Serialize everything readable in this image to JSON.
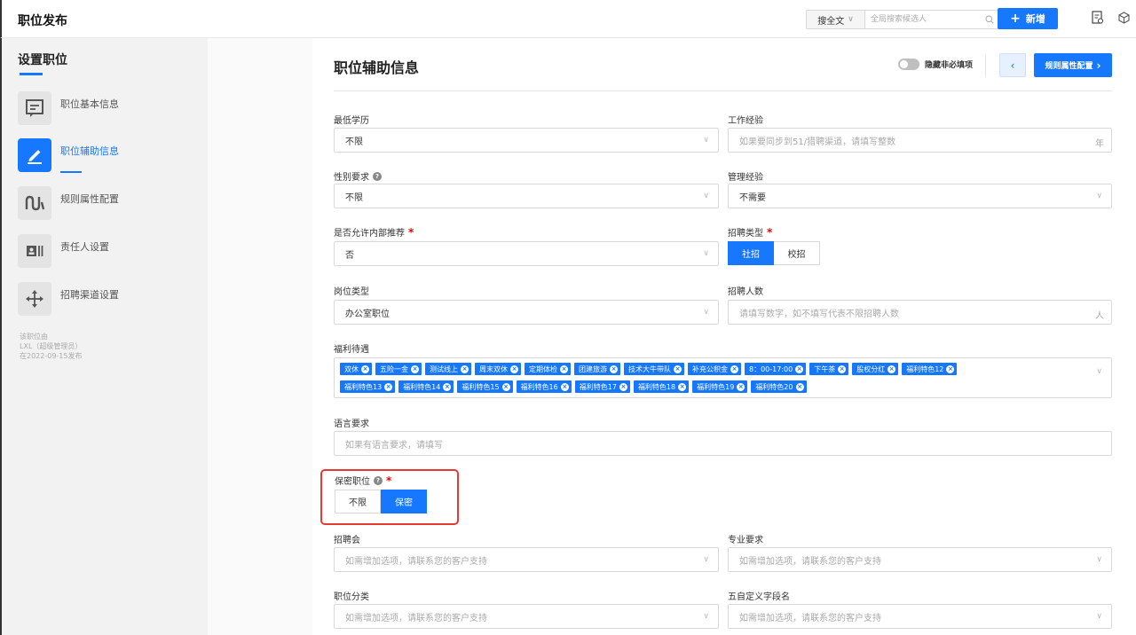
{
  "header": {
    "title": "职位发布",
    "search_scope": "搜全文",
    "search_placeholder": "全局搜索候选人",
    "new_button": "新增"
  },
  "sidebar": {
    "title": "设置职位",
    "items": [
      {
        "label": "职位基本信息",
        "icon": "document-icon"
      },
      {
        "label": "职位辅助信息",
        "icon": "edit-icon"
      },
      {
        "label": "规则属性配置",
        "icon": "curve-icon"
      },
      {
        "label": "责任人设置",
        "icon": "id-card-icon"
      },
      {
        "label": "招聘渠道设置",
        "icon": "move-icon"
      }
    ],
    "meta": {
      "line1": "该职位由",
      "line2": "LXL（超级管理员）",
      "line3": "在2022-09-15发布"
    }
  },
  "main": {
    "title": "职位辅助信息",
    "hide_optional_label": "隐藏非必填项",
    "next_button": "规则属性配置",
    "fields": {
      "education": {
        "label": "最低学历",
        "value": "不限"
      },
      "experience": {
        "label": "工作经验",
        "placeholder": "如果要同步到51/猎聘渠道，请填写整数",
        "suffix": "年"
      },
      "gender": {
        "label": "性别要求",
        "value": "不限"
      },
      "management": {
        "label": "管理经验",
        "value": "不需要"
      },
      "referral": {
        "label": "是否允许内部推荐",
        "value": "否"
      },
      "recruit_type": {
        "label": "招聘类型",
        "options": [
          "社招",
          "校招"
        ],
        "selected": "社招"
      },
      "position_type": {
        "label": "岗位类型",
        "value": "办公室职位"
      },
      "headcount": {
        "label": "招聘人数",
        "placeholder": "请填写数字，如不填写代表不限招聘人数",
        "suffix": "人"
      },
      "benefits": {
        "label": "福利待遇",
        "row1": [
          "双休",
          "五险一金",
          "测试线上",
          "周末双休",
          "定期体检",
          "团建旅游",
          "技术大牛带队",
          "补充公积金",
          "8：00-17:00",
          "下午茶",
          "股权分红",
          "福利特色12"
        ],
        "row2": [
          "福利特色13",
          "福利特色14",
          "福利特色15",
          "福利特色16",
          "福利特色17",
          "福利特色18",
          "福利特色19",
          "福利特色20"
        ]
      },
      "language": {
        "label": "语言要求",
        "placeholder": "如果有语言要求，请填写"
      },
      "confidential": {
        "label": "保密职位",
        "options": [
          "不限",
          "保密"
        ],
        "selected": "保密"
      },
      "job_fair": {
        "label": "招聘会",
        "placeholder": "如需增加选项，请联系您的客户支持"
      },
      "major": {
        "label": "专业要求",
        "placeholder": "如需增加选项，请联系您的客户支持"
      },
      "category": {
        "label": "职位分类",
        "placeholder": "如需增加选项，请联系您的客户支持"
      },
      "custom5": {
        "label": "五自定义字段名",
        "placeholder": "如需增加选项，请联系您的客户支持"
      }
    }
  },
  "colors": {
    "primary": "#1677ff",
    "required": "#e00000",
    "highlight": "#e53935"
  }
}
